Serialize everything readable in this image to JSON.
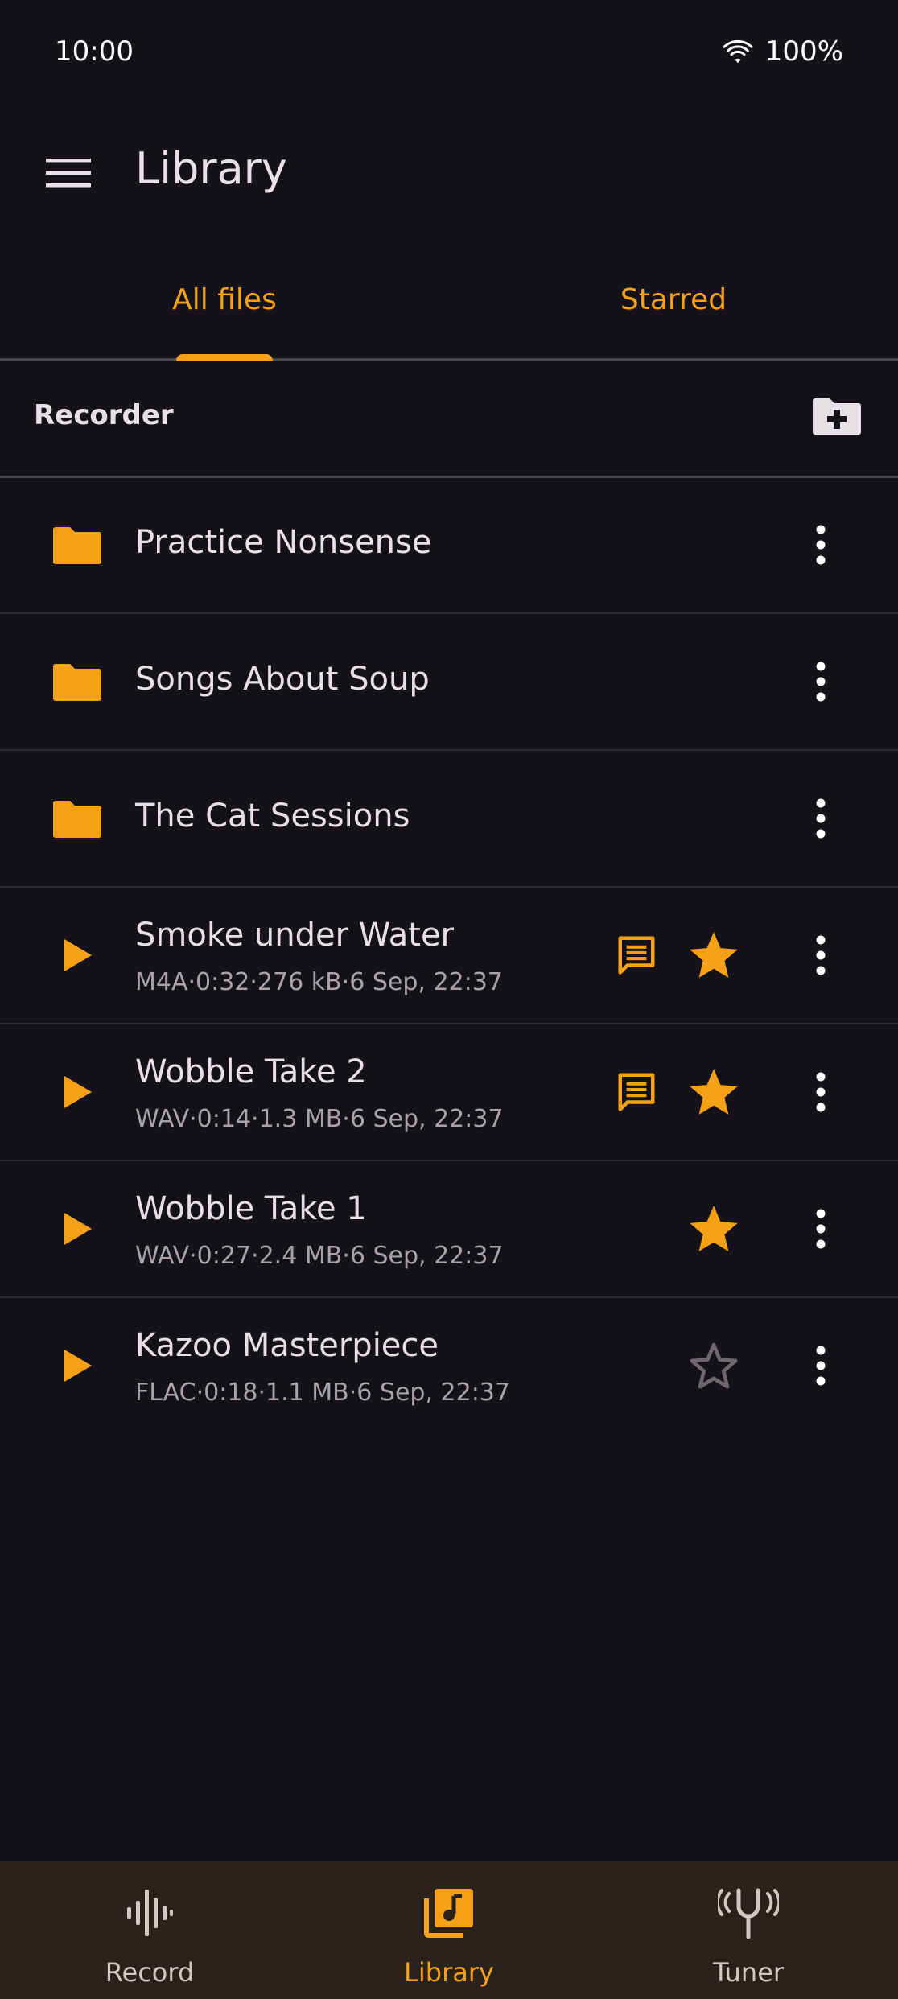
{
  "status_bar": {
    "time": "10:00",
    "battery": "100%"
  },
  "app_bar": {
    "title": "Library",
    "menu_icon": "menu-icon"
  },
  "tabs": [
    {
      "label": "All files",
      "selected": true
    },
    {
      "label": "Starred",
      "selected": false
    }
  ],
  "section": {
    "title": "Recorder",
    "action_icon": "create-folder-icon"
  },
  "folders": [
    {
      "name": "Practice Nonsense"
    },
    {
      "name": "Songs About Soup"
    },
    {
      "name": "The Cat Sessions"
    }
  ],
  "recordings": [
    {
      "title": "Smoke under Water",
      "meta": "M4A·0:32·276 kB·6 Sep, 22:37",
      "has_note": true,
      "starred": true
    },
    {
      "title": "Wobble Take 2",
      "meta": "WAV·0:14·1.3 MB·6 Sep, 22:37",
      "has_note": true,
      "starred": true
    },
    {
      "title": "Wobble Take 1",
      "meta": "WAV·0:27·2.4 MB·6 Sep, 22:37",
      "has_note": false,
      "starred": true
    },
    {
      "title": "Kazoo Masterpiece",
      "meta": "FLAC·0:18·1.1 MB·6 Sep, 22:37",
      "has_note": false,
      "starred": false
    }
  ],
  "bottom_nav": [
    {
      "label": "Record",
      "icon": "waveform-icon",
      "active": false
    },
    {
      "label": "Library",
      "icon": "music-library-icon",
      "active": true
    },
    {
      "label": "Tuner",
      "icon": "tuning-fork-icon",
      "active": false
    }
  ],
  "colors": {
    "accent": "#f5a118",
    "background": "#141218",
    "nav_background": "#2a221a"
  }
}
